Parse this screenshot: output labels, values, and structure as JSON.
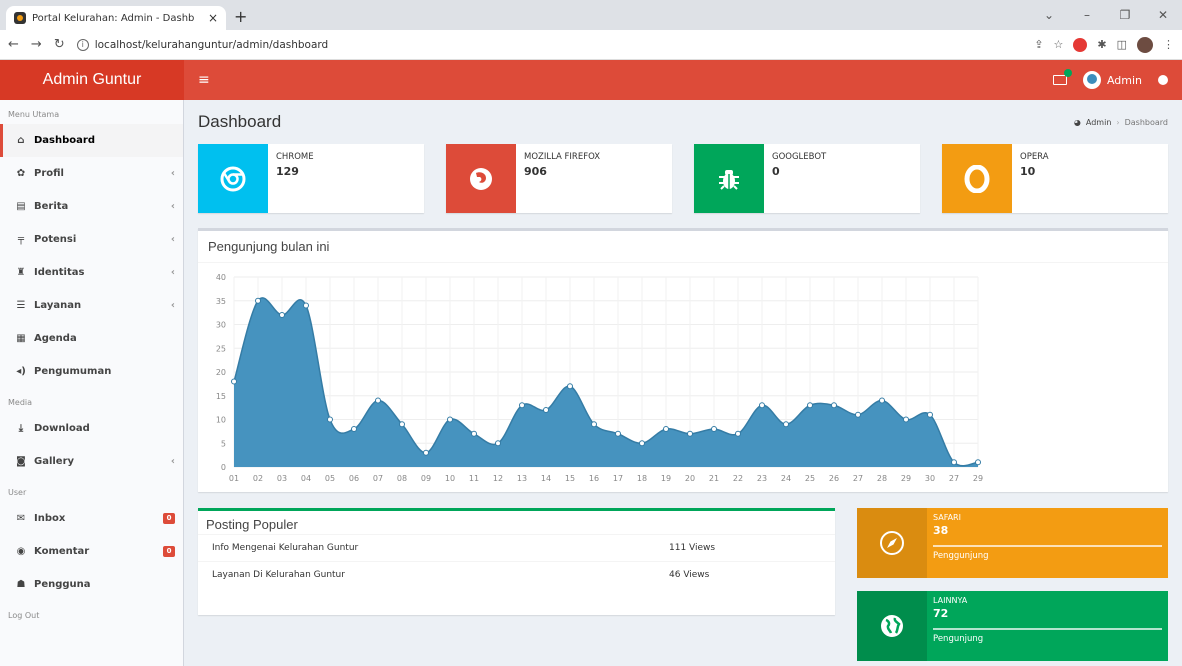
{
  "browser": {
    "tab_title": "Portal Kelurahan: Admin - Dashb",
    "tab_close": "×",
    "new_tab": "+",
    "url": "localhost/kelurahanguntur/admin/dashboard"
  },
  "header": {
    "brand": "Admin Guntur",
    "menu_icon": "≡",
    "user_name": "Admin"
  },
  "sidebar": {
    "sections": [
      {
        "heading": "Menu Utama",
        "items": [
          {
            "label": "Dashboard",
            "icon": "home-icon",
            "glyph": "⌂",
            "active": true
          },
          {
            "label": "Profil",
            "icon": "gear-icon",
            "glyph": "✿",
            "chevron": "‹"
          },
          {
            "label": "Berita",
            "icon": "newspaper-icon",
            "glyph": "▤",
            "chevron": "‹"
          },
          {
            "label": "Potensi",
            "icon": "signpost-icon",
            "glyph": "╤",
            "chevron": "‹"
          },
          {
            "label": "Identitas",
            "icon": "binoculars-icon",
            "glyph": "♜",
            "chevron": "‹"
          },
          {
            "label": "Layanan",
            "icon": "list-icon",
            "glyph": "☰",
            "chevron": "‹"
          },
          {
            "label": "Agenda",
            "icon": "calendar-icon",
            "glyph": "▦"
          },
          {
            "label": "Pengumuman",
            "icon": "volume-icon",
            "glyph": "◂)"
          }
        ]
      },
      {
        "heading": "Media",
        "items": [
          {
            "label": "Download",
            "icon": "download-icon",
            "glyph": "⤓"
          },
          {
            "label": "Gallery",
            "icon": "camera-icon",
            "glyph": "◙",
            "chevron": "‹"
          }
        ]
      },
      {
        "heading": "User",
        "items": [
          {
            "label": "Inbox",
            "icon": "envelope-icon",
            "glyph": "✉",
            "badge": "0"
          },
          {
            "label": "Komentar",
            "icon": "comments-icon",
            "glyph": "◉",
            "badge": "0"
          },
          {
            "label": "Pengguna",
            "icon": "users-icon",
            "glyph": "☗"
          }
        ]
      },
      {
        "heading": "Log Out",
        "items": []
      }
    ]
  },
  "content": {
    "title": "Dashboard",
    "breadcrumb": {
      "root": "Admin",
      "sep": "›",
      "current": "Dashboard"
    }
  },
  "stats": [
    {
      "label": "CHROME",
      "value": "129",
      "color": "#00c0ef",
      "icon": "chrome-icon"
    },
    {
      "label": "MOZILLA FIREFOX",
      "value": "906",
      "color": "#dd4b39",
      "icon": "firefox-icon"
    },
    {
      "label": "GOOGLEBOT",
      "value": "0",
      "color": "#00a65a",
      "icon": "bug-icon"
    },
    {
      "label": "OPERA",
      "value": "10",
      "color": "#f39c12",
      "icon": "opera-icon"
    }
  ],
  "chart_title": "Pengunjung bulan ini",
  "chart_data": {
    "type": "area",
    "categories": [
      "01",
      "02",
      "03",
      "04",
      "05",
      "06",
      "07",
      "08",
      "09",
      "10",
      "11",
      "12",
      "13",
      "14",
      "15",
      "16",
      "17",
      "18",
      "19",
      "20",
      "21",
      "22",
      "23",
      "24",
      "25",
      "26",
      "27",
      "28",
      "29",
      "30",
      "27",
      "29"
    ],
    "values": [
      18,
      35,
      32,
      34,
      10,
      8,
      14,
      9,
      3,
      10,
      7,
      5,
      13,
      12,
      17,
      9,
      7,
      5,
      8,
      7,
      8,
      7,
      13,
      9,
      13,
      13,
      11,
      14,
      10,
      11,
      1,
      1
    ],
    "yticks": [
      0,
      5,
      10,
      15,
      20,
      25,
      30,
      35,
      40
    ],
    "ylim": [
      0,
      40
    ],
    "color": "#3c8dbc",
    "grid": true
  },
  "posting": {
    "title": "Posting Populer",
    "rows": [
      {
        "title": "Info Mengenai Kelurahan Guntur",
        "views": "111 Views"
      },
      {
        "title": "Layanan Di Kelurahan Guntur",
        "views": "46 Views"
      }
    ]
  },
  "side_stats": [
    {
      "label": "SAFARI",
      "value": "38",
      "desc": "Penggunjung",
      "color": "#f39c12",
      "dark": "#da8c10",
      "icon": "compass-icon"
    },
    {
      "label": "LAINNYA",
      "value": "72",
      "desc": "Pengunjung",
      "color": "#00a65a",
      "dark": "#008d4c",
      "icon": "globe-icon"
    }
  ]
}
